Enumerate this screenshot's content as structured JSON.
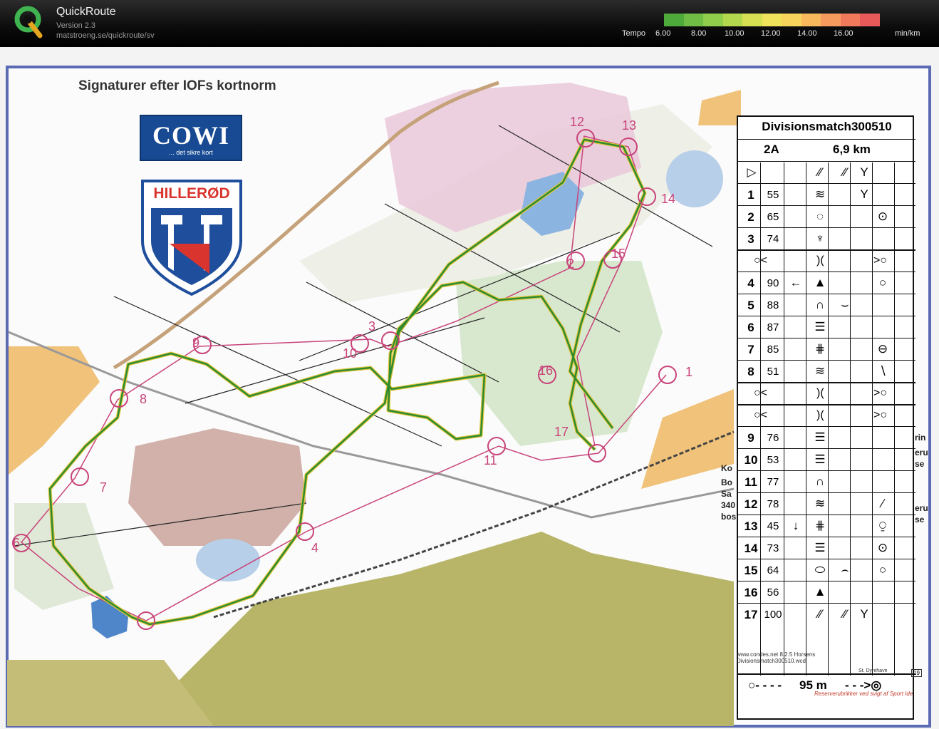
{
  "app": {
    "title": "QuickRoute",
    "version": "Version 2.3",
    "url": "matstroeng.se/quickroute/sv"
  },
  "legend": {
    "label": "Tempo",
    "ticks": [
      "6.00",
      "8.00",
      "10.00",
      "12.00",
      "14.00",
      "16.00"
    ],
    "unit": "min/km",
    "colors": [
      "#4faa3c",
      "#6fbd44",
      "#8fcd4a",
      "#b3d84d",
      "#d6e052",
      "#eee35a",
      "#f7d45b",
      "#f9b85c",
      "#f69a5d",
      "#f0795c",
      "#e85a5a"
    ]
  },
  "map": {
    "title": "Signaturer efter IOFs kortnorm",
    "cowi_name": "COWI",
    "cowi_tagline": "... det sikre kort",
    "club_name": "HILLERØD",
    "route_color": "#2e8b2e",
    "course_color": "#c8447a",
    "controls": [
      "1",
      "2",
      "3",
      "4",
      "6",
      "7",
      "8",
      "9",
      "10",
      "11",
      "12",
      "13",
      "14",
      "15",
      "16",
      "17"
    ],
    "side_text": [
      "Ko",
      "Bo",
      "Sa",
      "340",
      "bos"
    ],
    "side_text_right": [
      "rin",
      "eru",
      "se",
      "eru",
      "se"
    ],
    "card": {
      "title": "Divisionsmatch300510",
      "class": "2A",
      "length": "6,9 km",
      "rows": [
        {
          "num": "1",
          "code": "55"
        },
        {
          "num": "2",
          "code": "65"
        },
        {
          "num": "3",
          "code": "74"
        },
        {
          "num": "4",
          "code": "90"
        },
        {
          "num": "5",
          "code": "88"
        },
        {
          "num": "6",
          "code": "87"
        },
        {
          "num": "7",
          "code": "85"
        },
        {
          "num": "8",
          "code": "51"
        },
        {
          "num": "9",
          "code": "76"
        },
        {
          "num": "10",
          "code": "53"
        },
        {
          "num": "11",
          "code": "77"
        },
        {
          "num": "12",
          "code": "78"
        },
        {
          "num": "13",
          "code": "45"
        },
        {
          "num": "14",
          "code": "73"
        },
        {
          "num": "15",
          "code": "64"
        },
        {
          "num": "16",
          "code": "56"
        },
        {
          "num": "17",
          "code": "100"
        }
      ],
      "finish_text": "95 m",
      "software": "www.condes.net 8.2.5 Horsens",
      "file": "Divisionsmatch300510.wcd",
      "grid_number": "19",
      "place_name": "St. Dyrehave",
      "reserve_text": "Reserverubrikker ved svigt af Sport Ide"
    }
  }
}
